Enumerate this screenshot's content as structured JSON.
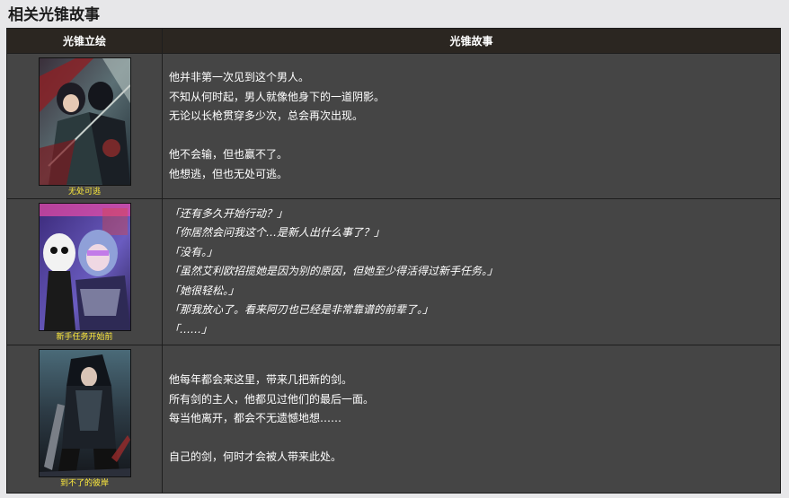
{
  "page": {
    "section_title": "相关光锥故事"
  },
  "table": {
    "headers": [
      "光锥立绘",
      "光锥故事"
    ],
    "rows": [
      {
        "caption": "无处可逃",
        "lines": [
          "他并非第一次见到这个男人。",
          "不知从何时起，男人就像他身下的一道阴影。",
          "无论以长枪贯穿多少次，总会再次出现。",
          "",
          "他不会输，但也赢不了。",
          "他想逃，但也无处可逃。"
        ]
      },
      {
        "caption": "新手任务开始前",
        "lines": [
          "「还有多久开始行动？」",
          "「你居然会问我这个…是新人出什么事了？」",
          "「没有。」",
          "「虽然艾利欧招揽她是因为别的原因，但她至少得活得过新手任务。」",
          "「她很轻松。」",
          "「那我放心了。看来阿刃也已经是非常靠谱的前辈了。」",
          "「……」"
        ]
      },
      {
        "caption": "到不了的彼岸",
        "lines": [
          "他每年都会来这里，带来几把新的剑。",
          "所有剑的主人，他都见过他们的最后一面。",
          "每当他离开，都会不无遗憾地想……",
          "",
          "自己的剑，何时才会被人带来此处。"
        ]
      }
    ]
  },
  "colors": {
    "caption": "#ffec3d",
    "header_bg": "#2b2621",
    "cell_bg": "#454545"
  }
}
